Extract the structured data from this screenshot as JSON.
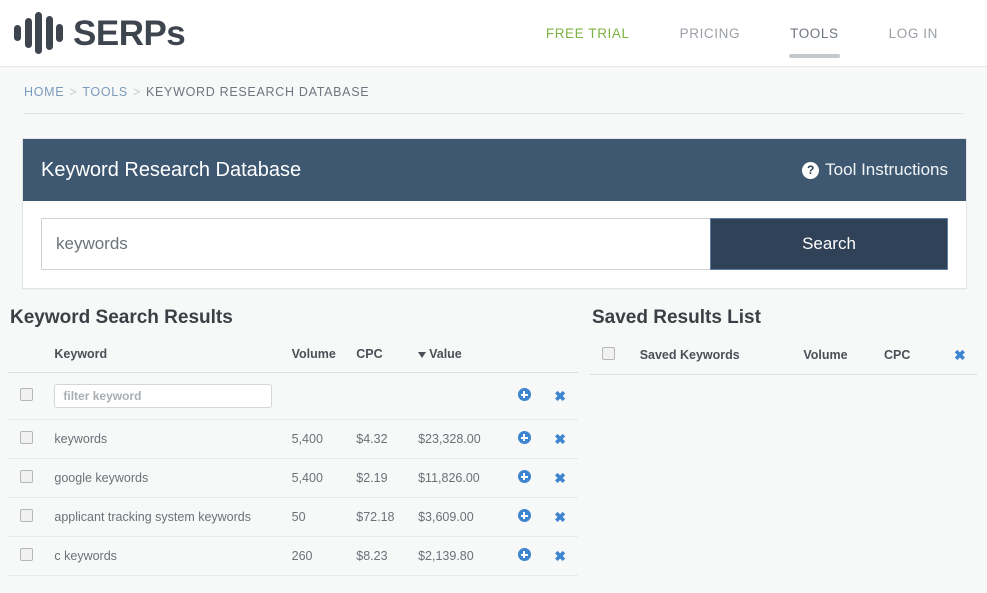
{
  "header": {
    "brand_name": "SERPs",
    "logo_icon": "waveform-logo-icon",
    "nav": [
      {
        "label": "FREE TRIAL",
        "style": "accent",
        "active": false
      },
      {
        "label": "PRICING",
        "style": "muted",
        "active": false
      },
      {
        "label": "TOOLS",
        "style": "muted",
        "active": true
      },
      {
        "label": "LOG IN",
        "style": "muted",
        "active": false
      }
    ]
  },
  "breadcrumb": {
    "home": "HOME",
    "tools": "TOOLS",
    "current": "KEYWORD RESEARCH DATABASE",
    "separator": ">"
  },
  "tool_panel": {
    "title": "Keyword Research Database",
    "instructions_label": "Tool Instructions",
    "help_icon": "question-mark-circle-icon",
    "help_glyph": "?",
    "header_bg": "#3e5871",
    "search": {
      "value": "keywords",
      "placeholder": "keywords",
      "button_label": "Search",
      "button_bg": "#2f4257"
    }
  },
  "results": {
    "title": "Keyword Search Results",
    "columns": {
      "keyword": "Keyword",
      "volume": "Volume",
      "cpc": "CPC",
      "value": "Value"
    },
    "sort": {
      "column": "Value",
      "direction": "desc",
      "caret": "▼"
    },
    "filter_row": {
      "placeholder": "filter keyword",
      "value": ""
    },
    "rows": [
      {
        "keyword": "keywords",
        "volume": "5,400",
        "cpc": "$4.32",
        "value": "$23,328.00",
        "checked": false
      },
      {
        "keyword": "google keywords",
        "volume": "5,400",
        "cpc": "$2.19",
        "value": "$11,826.00",
        "checked": false
      },
      {
        "keyword": "applicant tracking system keywords",
        "volume": "50",
        "cpc": "$72.18",
        "value": "$3,609.00",
        "checked": false
      },
      {
        "keyword": "c keywords",
        "volume": "260",
        "cpc": "$8.23",
        "value": "$2,139.80",
        "checked": false
      }
    ],
    "row_actions": {
      "add_icon": "add-circle-icon",
      "remove_icon": "remove-x-icon",
      "remove_glyph": "✖"
    }
  },
  "saved": {
    "title": "Saved Results List",
    "columns": {
      "keyword": "Saved Keywords",
      "volume": "Volume",
      "cpc": "CPC"
    },
    "clear_icon": "clear-x-icon",
    "clear_glyph": "✖",
    "rows": []
  },
  "colors": {
    "accent_green": "#7cb342",
    "link_blue": "#7b9bbd",
    "icon_blue": "#3d85d0",
    "panel_navy": "#3e5871",
    "button_navy": "#2f4257",
    "page_bg": "#f7f8f8"
  }
}
